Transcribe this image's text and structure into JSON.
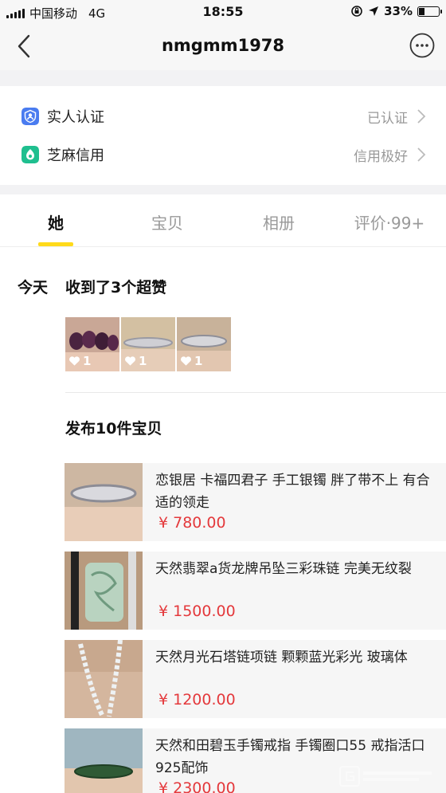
{
  "status_bar": {
    "carrier": "中国移动",
    "network": "4G",
    "time": "18:55",
    "battery": "33%",
    "battery_level": 0.33
  },
  "nav": {
    "title": "nmgmm1978"
  },
  "verification": [
    {
      "label": "实人认证",
      "status": "已认证",
      "icon": "person-verify-icon",
      "color": "#4a7cf0"
    },
    {
      "label": "芝麻信用",
      "status": "信用极好",
      "icon": "sesame-credit-icon",
      "color": "#1fbf8f"
    }
  ],
  "tabs": [
    "她",
    "宝贝",
    "相册",
    "评价·99+"
  ],
  "timeline": {
    "day": "今天",
    "likes_title": "收到了3个超赞",
    "liked_items": [
      {
        "count": "1"
      },
      {
        "count": "1"
      },
      {
        "count": "1"
      }
    ],
    "published_title": "发布10件宝贝",
    "items": [
      {
        "name": "恋银居  卡福四君子 手工银镯 胖了带不上 有合适的领走",
        "price": "¥ 780.00"
      },
      {
        "name": "天然翡翠a货龙牌吊坠三彩珠链 完美无纹裂",
        "price": "¥ 1500.00"
      },
      {
        "name": "天然月光石塔链项链 颗颗蓝光彩光 玻璃体",
        "price": "¥ 1200.00"
      },
      {
        "name": "天然和田碧玉手镯戒指 手镯圈口55 戒指活口925配饰",
        "price": "¥ 2300.00"
      }
    ]
  },
  "colors": {
    "accent": "#ffda1a",
    "price": "#e4393c"
  }
}
